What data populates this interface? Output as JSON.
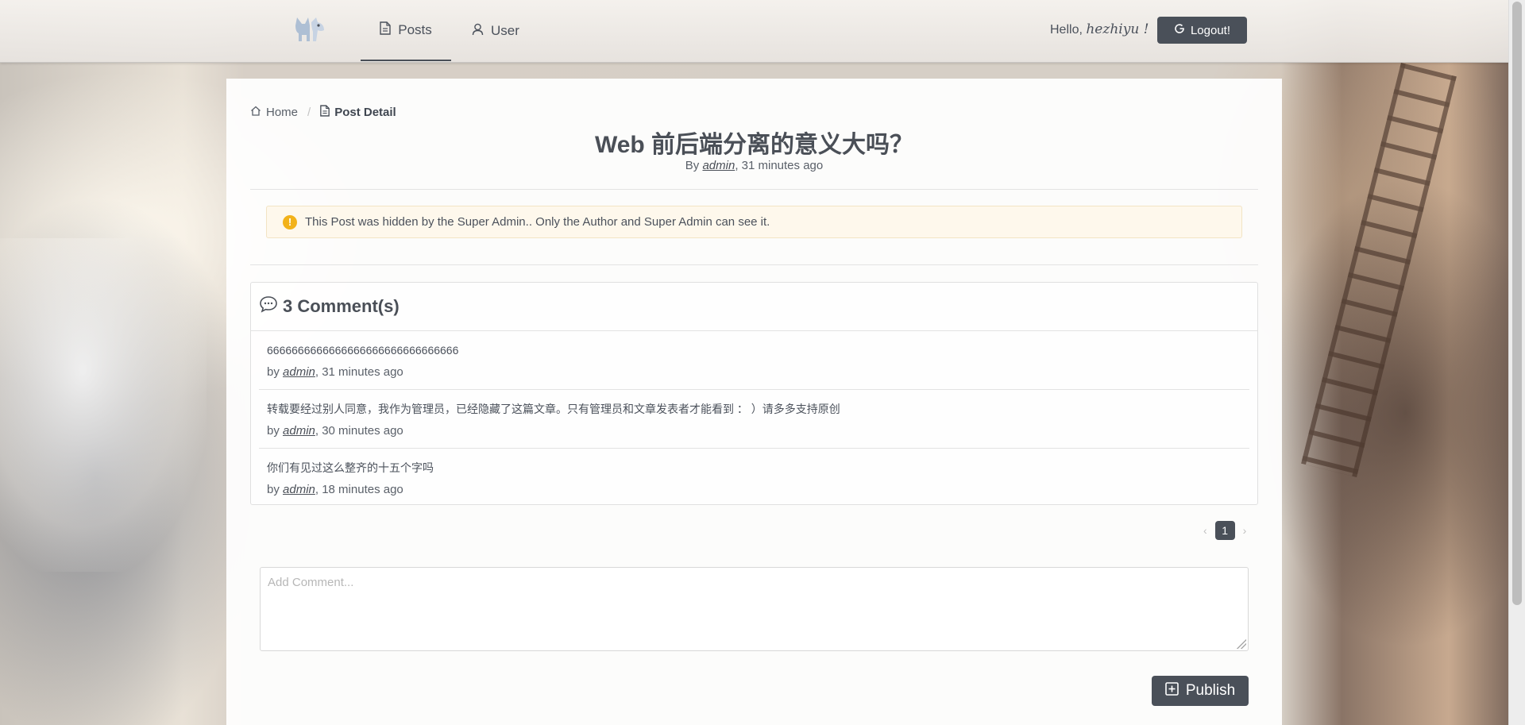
{
  "nav": {
    "logo_icon": "dog-logo-icon",
    "items": [
      {
        "label": "Posts",
        "icon": "document-icon",
        "active": true
      },
      {
        "label": "User",
        "icon": "user-icon",
        "active": false
      }
    ],
    "hello_prefix": "Hello,",
    "username": "hezhiyu !",
    "logout_label": "Logout!"
  },
  "breadcrumb": {
    "home": "Home",
    "current": "Post Detail"
  },
  "post": {
    "title": "Web 前后端分离的意义大吗？",
    "by": "By",
    "author": "admin",
    "time": ", 31 minutes ago"
  },
  "warning": {
    "icon": "exclamation-icon",
    "text": "This Post was hidden by the Super Admin.. Only the Author and Super Admin can see it."
  },
  "comments": {
    "title": "3 Comment(s)",
    "by": "by",
    "items": [
      {
        "text": "6666666666666666666666666666666",
        "author": "admin",
        "time": ", 31 minutes ago"
      },
      {
        "text": "转载要经过别人同意，我作为管理员，已经隐藏了这篇文章。只有管理员和文章发表者才能看到 ： ）请多多支持原创",
        "author": "admin",
        "time": ", 30 minutes ago"
      },
      {
        "text": "你们有见过这么整齐的十五个字吗",
        "author": "admin",
        "time": ", 18 minutes ago"
      }
    ]
  },
  "pagination": {
    "prev": "‹",
    "current": "1",
    "next": "›"
  },
  "composer": {
    "placeholder": "Add Comment...",
    "value": "",
    "publish_label": "Publish"
  },
  "colors": {
    "primary_button": "#4a5059",
    "warning_bg": "#fef8ec",
    "warning_icon": "#f2b21a"
  }
}
